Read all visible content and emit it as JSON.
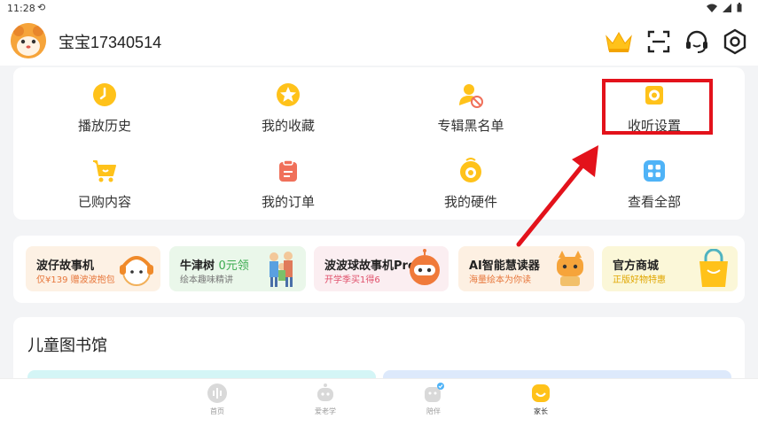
{
  "status_bar": {
    "time": "11:28",
    "notify_glyph": "⟲"
  },
  "header": {
    "username": "宝宝17340514"
  },
  "menu": {
    "items": [
      {
        "label": "播放历史",
        "icon": "clock-icon"
      },
      {
        "label": "我的收藏",
        "icon": "star-icon"
      },
      {
        "label": "专辑黑名单",
        "icon": "user-block-icon"
      },
      {
        "label": "收听设置",
        "icon": "listen-settings-icon"
      },
      {
        "label": "已购内容",
        "icon": "cart-icon"
      },
      {
        "label": "我的订单",
        "icon": "order-icon"
      },
      {
        "label": "我的硬件",
        "icon": "device-icon"
      },
      {
        "label": "查看全部",
        "icon": "grid-icon"
      }
    ]
  },
  "promos": [
    {
      "title": "波仔故事机",
      "title_extra": "",
      "subtitle": "仅¥139 赠波波抱包",
      "bg": "#fdf1e4",
      "sub_color": "#e7763a"
    },
    {
      "title": "牛津树 ",
      "title_extra": "0元领",
      "subtitle": "绘本趣味精讲",
      "bg": "#eaf7ea",
      "sub_color": "#777777"
    },
    {
      "title": "波波球故事机Pro",
      "title_extra": "",
      "subtitle": "开学季买1得6",
      "bg": "#fbeef1",
      "sub_color": "#e0506b"
    },
    {
      "title": "AI智能慧读器",
      "title_extra": "",
      "subtitle": "海量绘本为你读",
      "bg": "#fdf0e2",
      "sub_color": "#e7763a"
    },
    {
      "title": "官方商城",
      "title_extra": "",
      "subtitle": "正版好物特惠",
      "bg": "#fbf7d8",
      "sub_color": "#e0a600"
    }
  ],
  "library": {
    "title": "儿童图书馆"
  },
  "tabbar": {
    "tabs": [
      {
        "label": "首页",
        "active": false
      },
      {
        "label": "爱老学",
        "active": false
      },
      {
        "label": "陪伴",
        "active": false
      },
      {
        "label": "家长",
        "active": true
      }
    ]
  },
  "colors": {
    "accent": "#ffc21a",
    "highlight": "#e3121b",
    "icon_blue": "#4f8ff7",
    "icon_red": "#f0705a"
  }
}
